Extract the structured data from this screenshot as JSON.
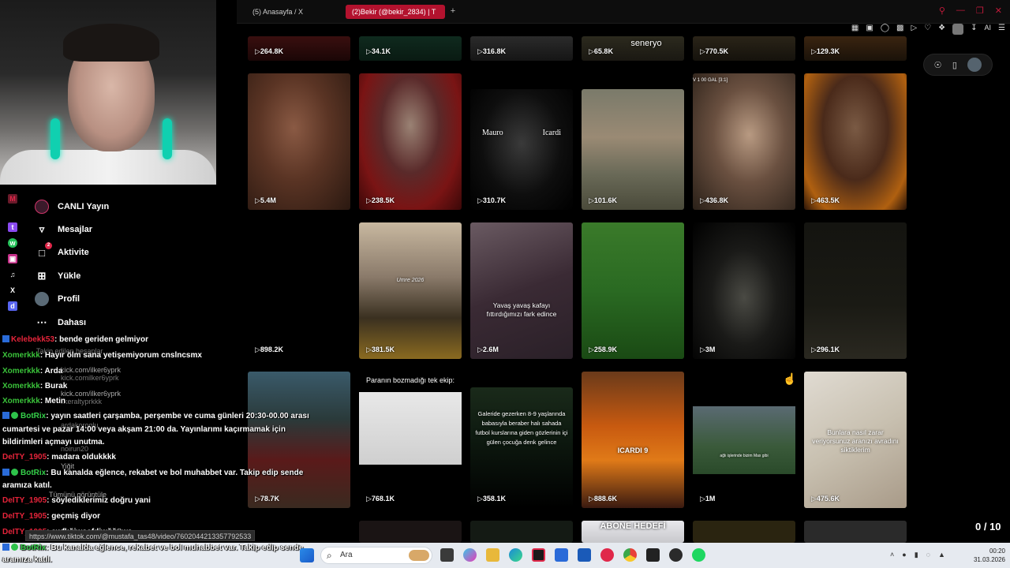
{
  "browser": {
    "tabs": [
      {
        "label": "(5) Anasayfa / X"
      },
      {
        "label": "(2)Bekir (@bekir_2834) | T"
      }
    ],
    "tab_new": "+",
    "ai_label": "AI",
    "accent": "#b3122e"
  },
  "grid": {
    "row0": [
      {
        "views": "264.8K",
        "caption": ""
      },
      {
        "views": "34.1K",
        "caption": ""
      },
      {
        "views": "316.8K",
        "caption": ""
      },
      {
        "views": "65.8K",
        "caption": "seneryo"
      },
      {
        "views": "770.5K",
        "caption": ""
      },
      {
        "views": "129.3K",
        "caption": ""
      }
    ],
    "row1": [
      {
        "views": "5.4M",
        "caption": ""
      },
      {
        "views": "238.5K",
        "caption": ""
      },
      {
        "views": "310.7K",
        "caption": "Mauro                    Icardi"
      },
      {
        "views": "101.6K",
        "caption": ""
      },
      {
        "views": "436.8K",
        "caption": "V 1 00 GAL [3:1]"
      },
      {
        "views": "463.5K",
        "caption": ""
      }
    ],
    "row2": [
      {
        "views": "898.2K",
        "caption": ""
      },
      {
        "views": "381.5K",
        "caption": "Umre 2026"
      },
      {
        "views": "2.6M",
        "caption": "Yavaş yavaş kafayı fıttırdığımızı fark edince"
      },
      {
        "views": "258.9K",
        "caption": ""
      },
      {
        "views": "3M",
        "caption": ""
      },
      {
        "views": "296.1K",
        "caption": ""
      }
    ],
    "row3": [
      {
        "views": "78.7K",
        "caption": ""
      },
      {
        "views": "768.1K",
        "caption": "Paranın bozmadığı tek ekip:"
      },
      {
        "views": "358.1K",
        "caption": "Galeride gezerken 8-9 yaşlarında babasıyla beraber halı sahada futbol kurslarına giden gözlerinin içi gülen çocuğa denk gelince"
      },
      {
        "views": "888.6K",
        "caption": "ICARDI 9"
      },
      {
        "views": "1M",
        "caption": "ağlı işlerinde bizim Max gibi"
      },
      {
        "views": "475.6K",
        "caption": "Bunlara nasıl zarar veriyorsunuz aranızı avradını siktiklerim"
      }
    ],
    "row4_caption": "ABONE HEDEFİ",
    "scroll_counter": "0 / 10"
  },
  "nav": {
    "items": [
      {
        "label": "CANLI Yayın",
        "icon": "live-icon"
      },
      {
        "label": "Mesajlar",
        "icon": "send-icon"
      },
      {
        "label": "Aktivite",
        "icon": "activity-icon",
        "badge": "2"
      },
      {
        "label": "Yükle",
        "icon": "upload-icon"
      },
      {
        "label": "Profil",
        "icon": "profile-icon"
      },
      {
        "label": "Dahası",
        "icon": "more-icon"
      }
    ]
  },
  "ghost": {
    "following_title": "Takip edilen hesaplar",
    "acc1": "kick.com/ilker6yprk",
    "acc1_sub": "kick.comilker6yprk",
    "acc2": "kick.com/ilker6yprk",
    "acc2_sub": "ilkeraltyprkkk",
    "acc3": "ardakoroglu",
    "acc4": "noirun20",
    "acc5": "Yiğit",
    "see_all": "Tümünü görüntüle"
  },
  "chat": [
    {
      "user": "Kelebekk53",
      "text": ": bende geriden gelmiyor",
      "color": "#e5243a",
      "icon": "box"
    },
    {
      "user": "Xomerkkk",
      "text": ": Hayır ölm sana yetişemiyorum cnslncsmx",
      "color": "#3ac23a",
      "icon": ""
    },
    {
      "user": "Xomerkkk",
      "text": ": Arda",
      "color": "#3ac23a",
      "icon": ""
    },
    {
      "user": "Xomerkkk",
      "text": ": Burak",
      "color": "#3ac23a",
      "icon": ""
    },
    {
      "user": "Xomerkkk",
      "text": ": Metin",
      "color": "#3ac23a",
      "icon": ""
    },
    {
      "user": "BotRix",
      "text": ": yayın saatleri çarşamba, perşembe ve cuma günleri 20:30-00.00 arası",
      "color": "#35d04a",
      "icon": "both"
    },
    {
      "user": "",
      "text": "cumartesi ve pazar 14:00 veya akşam 21:00 da. Yayınlarımı kaçırmamak için",
      "color": "#ffffff",
      "icon": ""
    },
    {
      "user": "",
      "text": "bildirimleri açmayı unutma.",
      "color": "#ffffff",
      "icon": ""
    },
    {
      "user": "DeITY_1905",
      "text": ": madara oldukkkk",
      "color": "#e5243a",
      "icon": ""
    },
    {
      "user": "BotRix",
      "text": ": Bu kanalda eğlence, rekabet ve bol muhabbet var. Takip edip sende",
      "color": "#35d04a",
      "icon": "both"
    },
    {
      "user": "",
      "text": "aramıza katıl.",
      "color": "#ffffff",
      "icon": ""
    },
    {
      "user": "DeITY_1905",
      "text": ": söylediklerimiz doğru yani",
      "color": "#e5243a",
      "icon": ""
    },
    {
      "user": "DeITY_1905",
      "text": ": geçmiş diyor",
      "color": "#e5243a",
      "icon": ""
    },
    {
      "user": "DeITY_1905",
      "text": ": awfkğiwoafdjwğğüws",
      "color": "#e5243a",
      "icon": ""
    },
    {
      "user": "BotRix",
      "text": ": Bu kanalda eğlence, rekabet ve bol muhabbet var. Takip edip sende",
      "color": "#35d04a",
      "icon": "both"
    },
    {
      "user": "",
      "text": "aramıza katıl.",
      "color": "#ffffff",
      "icon": ""
    }
  ],
  "status_url": "https://www.tiktok.com/@mustafa_tas48/video/7602044213357792533",
  "taskbar": {
    "search_placeholder": "Ara",
    "time": "00:20",
    "date": "31.03.2026"
  }
}
